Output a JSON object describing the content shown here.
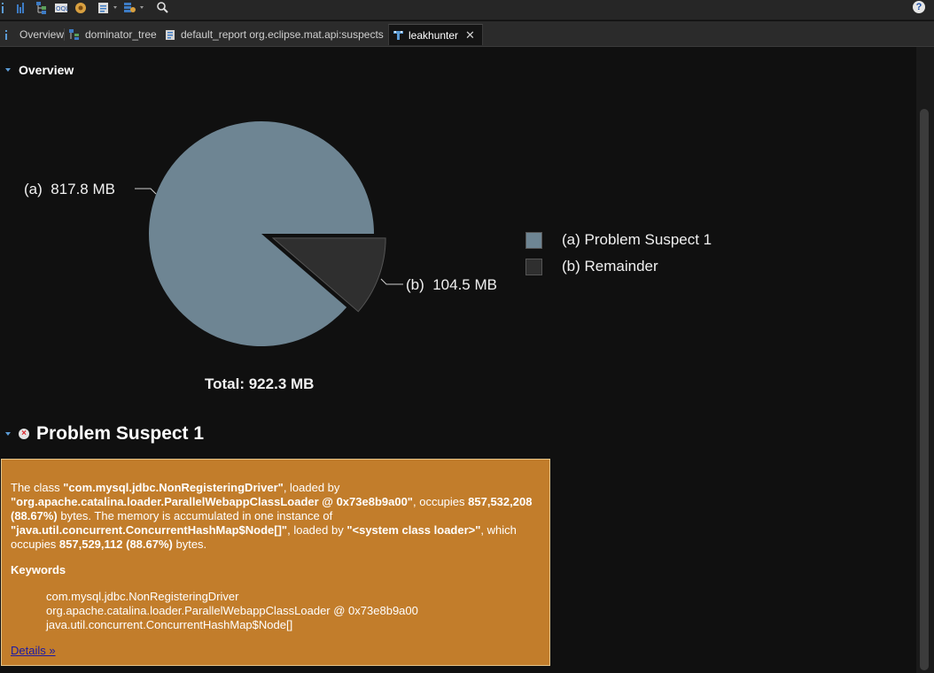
{
  "toolbar": {
    "icons": [
      "info-icon",
      "histogram-icon",
      "dominator-tree-icon",
      "oql-icon",
      "thread-overview-icon",
      "query-browser-icon",
      "find-object-icon",
      "search-icon",
      "help-icon"
    ],
    "help_glyph": "?"
  },
  "tabs": [
    {
      "label": "Overview",
      "icon": "info-icon"
    },
    {
      "label": "dominator_tree",
      "icon": "tree-icon"
    },
    {
      "label": "default_report org.eclipse.mat.api:suspects",
      "icon": "report-icon"
    },
    {
      "label": "leakhunter",
      "icon": "leakhunter-icon",
      "active": true,
      "close_glyph": "✕"
    }
  ],
  "overview": {
    "title": "Overview",
    "total": "Total: 922.3 MB",
    "legend": [
      {
        "label": "(a)  Problem Suspect 1",
        "color": "#6e8593"
      },
      {
        "label": "(b)  Remainder",
        "color": "#2f2f2f"
      }
    ]
  },
  "chart_data": {
    "type": "pie",
    "title": "",
    "slices": [
      {
        "name": "(a)  Problem Suspect 1",
        "label": "(a)  817.8 MB",
        "value": 817.8,
        "color": "#6e8593"
      },
      {
        "name": "(b)  Remainder",
        "label": "(b)  104.5 MB",
        "value": 104.5,
        "color": "#2f2f2f",
        "exploded": true
      }
    ],
    "total": 922.3,
    "unit": "MB"
  },
  "suspect": {
    "title": "Problem Suspect 1",
    "icon": "error-icon",
    "class_name": "\"com.mysql.jdbc.NonRegisteringDriver\"",
    "class_loader": "\"org.apache.catalina.loader.ParallelWebappClassLoader @ 0x73e8b9a00\"",
    "occupies": "857,532,208 (88.67%)",
    "instance_type": "\"java.util.concurrent.ConcurrentHashMap$Node[]\"",
    "instance_loader": "\"<system class loader>\"",
    "instance_occupies": "857,529,112 (88.67%)",
    "text": {
      "the_class": "The class ",
      "loaded_by": ", loaded by ",
      "occupies": ", occupies ",
      "memory_accumulated": " bytes. The memory is accumulated in one instance of ",
      "loaded_by_2": ", loaded by ",
      "which_occupies": ", which occupies ",
      "bytes_end": " bytes."
    },
    "keywords_title": "Keywords",
    "keywords": [
      "com.mysql.jdbc.NonRegisteringDriver",
      "org.apache.catalina.loader.ParallelWebappClassLoader @ 0x73e8b9a00",
      "java.util.concurrent.ConcurrentHashMap$Node[]"
    ],
    "details_link": "Details »"
  }
}
